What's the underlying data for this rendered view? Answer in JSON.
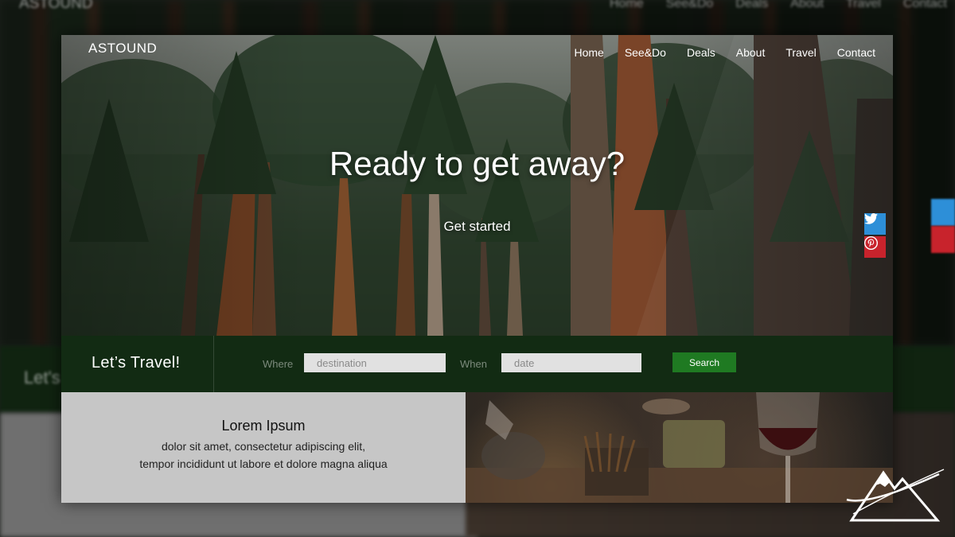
{
  "backdrop": {
    "logo": "ASTOUND",
    "nav": [
      "Home",
      "See&Do",
      "Deals",
      "About",
      "Travel",
      "Contact"
    ],
    "bar_title": "Let's"
  },
  "header": {
    "logo": "ASTOUND",
    "nav": [
      {
        "label": "Home"
      },
      {
        "label": "See&Do"
      },
      {
        "label": "Deals"
      },
      {
        "label": "About"
      },
      {
        "label": "Travel"
      },
      {
        "label": "Contact"
      }
    ]
  },
  "hero": {
    "headline": "Ready to get away?",
    "cta": "Get started"
  },
  "social": {
    "icons": [
      "twitter-icon",
      "pinterest-icon"
    ],
    "colors": {
      "twitter": "#2d8fd8",
      "pinterest": "#c8232c"
    }
  },
  "search": {
    "title": "Let’s Travel!",
    "where_label": "Where",
    "where_placeholder": "destination",
    "when_label": "When",
    "when_placeholder": "date",
    "button": "Search",
    "colors": {
      "bar": "#122b13",
      "button": "#1f7a22"
    }
  },
  "feature": {
    "title": "Lorem Ipsum",
    "line1": "dolor sit amet, consectetur adipiscing elit,",
    "line2": "tempor incididunt ut labore et dolore magna aliqua"
  },
  "brand_mark": {
    "icon": "mountain-logo-icon"
  }
}
